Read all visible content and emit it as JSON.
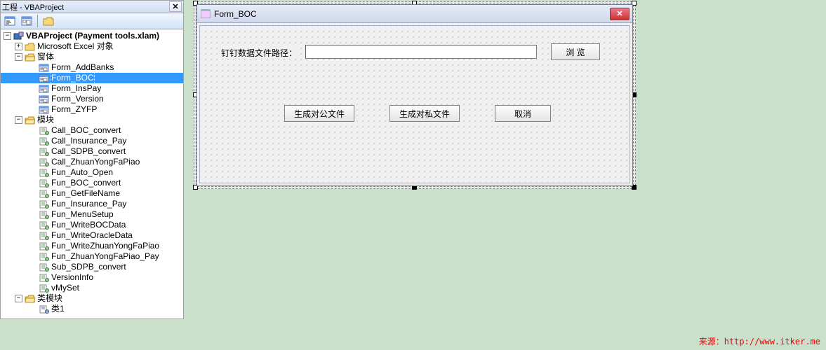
{
  "project_panel": {
    "title": "工程 - VBAProject",
    "close_glyph": "✕",
    "root": {
      "label": "VBAProject (Payment tools.xlam)",
      "twist": "−"
    },
    "excel_objects": {
      "label": "Microsoft Excel 对象",
      "twist": "+"
    },
    "forms_folder": {
      "label": "窗体",
      "twist": "−"
    },
    "forms": [
      {
        "name": "Form_AddBanks"
      },
      {
        "name": "Form_BOC",
        "selected": true
      },
      {
        "name": "Form_InsPay"
      },
      {
        "name": "Form_Version"
      },
      {
        "name": "Form_ZYFP"
      }
    ],
    "modules_folder": {
      "label": "模块",
      "twist": "−"
    },
    "modules": [
      "Call_BOC_convert",
      "Call_Insurance_Pay",
      "Call_SDPB_convert",
      "Call_ZhuanYongFaPiao",
      "Fun_Auto_Open",
      "Fun_BOC_convert",
      "Fun_GetFileName",
      "Fun_Insurance_Pay",
      "Fun_MenuSetup",
      "Fun_WriteBOCData",
      "Fun_WriteOracleData",
      "Fun_WriteZhuanYongFaPiao",
      "Fun_ZhuanYongFaPiao_Pay",
      "Sub_SDPB_convert",
      "VersionInfo",
      "vMySet"
    ],
    "class_modules_folder": {
      "label": "类模块",
      "twist": "−"
    },
    "class_modules": [
      "类1"
    ]
  },
  "form_designer": {
    "title": "Form_BOC",
    "label_path": "钉钉数据文件路径：",
    "input_value": "",
    "btn_browse": "浏 览",
    "btn_public": "生成对公文件",
    "btn_private": "生成对私文件",
    "btn_cancel": "取消"
  },
  "watermark": "来源：http://www.itker.me"
}
